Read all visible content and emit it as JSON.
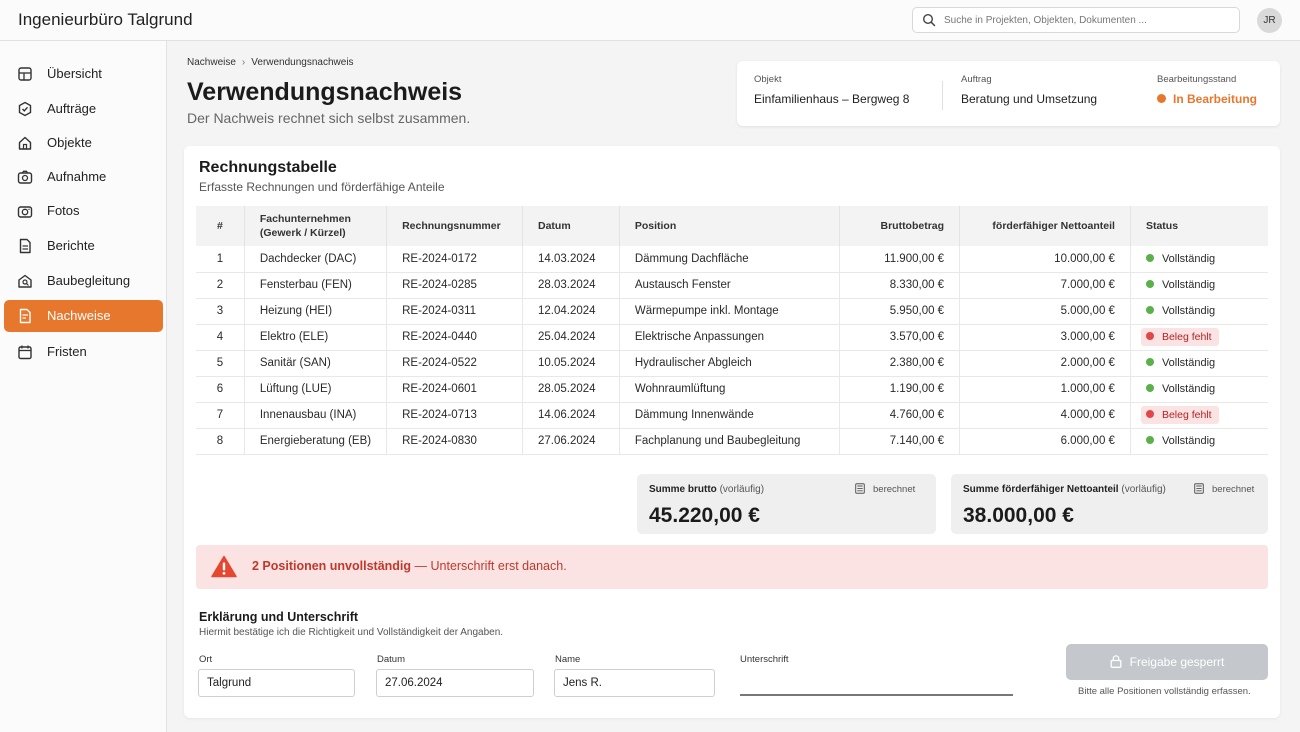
{
  "app": {
    "title": "Ingenieurbüro Talgrund"
  },
  "search": {
    "placeholder": "Suche in Projekten, Objekten, Dokumenten ..."
  },
  "user": {
    "initials": "JR"
  },
  "sidebar": {
    "items": [
      {
        "label": "Übersicht",
        "icon": "dashboard-icon"
      },
      {
        "label": "Aufträge",
        "icon": "order-badge-icon"
      },
      {
        "label": "Objekte",
        "icon": "home-icon"
      },
      {
        "label": "Aufnahme",
        "icon": "camera-icon"
      },
      {
        "label": "Fotos",
        "icon": "photo-camera-icon"
      },
      {
        "label": "Berichte",
        "icon": "document-icon"
      },
      {
        "label": "Baubegleitung",
        "icon": "building-icon"
      },
      {
        "label": "Nachweise",
        "icon": "certificate-icon",
        "active": true
      },
      {
        "label": "Fristen",
        "icon": "calendar-icon"
      }
    ]
  },
  "breadcrumb": {
    "parent": "Nachweise",
    "current": "Verwendungsnachweis"
  },
  "page": {
    "title": "Verwendungsnachweis",
    "subtitle": "Der Nachweis rechnet sich selbst zusammen."
  },
  "info": {
    "object_label": "Objekt",
    "object_value": "Einfamilienhaus – Bergweg 8",
    "order_label": "Auftrag",
    "order_value": "Beratung und Umsetzung",
    "state_label": "Bearbeitungsstand",
    "state_value": "In Bearbeitung"
  },
  "table": {
    "title": "Rechnungstabelle",
    "subtitle": "Erfasste Rechnungen und förderfähige Anteile",
    "headers": {
      "num": "#",
      "company_line1": "Fachunternehmen",
      "company_line2": "(Gewerk / Kürzel)",
      "invoice": "Rechnungsnummer",
      "date": "Datum",
      "position": "Position",
      "gross": "Bruttobetrag",
      "net": "förderfähiger Nettoanteil",
      "status": "Status"
    },
    "rows": [
      {
        "num": "1",
        "company": "Dachdecker (DAC)",
        "invoice": "RE-2024-0172",
        "date": "14.03.2024",
        "position": "Dämmung Dachfläche",
        "gross": "11.900,00 €",
        "net": "10.000,00 €",
        "status": "Vollständig",
        "ok": true
      },
      {
        "num": "2",
        "company": "Fensterbau (FEN)",
        "invoice": "RE-2024-0285",
        "date": "28.03.2024",
        "position": "Austausch Fenster",
        "gross": "8.330,00 €",
        "net": "7.000,00 €",
        "status": "Vollständig",
        "ok": true
      },
      {
        "num": "3",
        "company": "Heizung (HEI)",
        "invoice": "RE-2024-0311",
        "date": "12.04.2024",
        "position": "Wärmepumpe inkl. Montage",
        "gross": "5.950,00 €",
        "net": "5.000,00 €",
        "status": "Vollständig",
        "ok": true
      },
      {
        "num": "4",
        "company": "Elektro (ELE)",
        "invoice": "RE-2024-0440",
        "date": "25.04.2024",
        "position": "Elektrische Anpassungen",
        "gross": "3.570,00 €",
        "net": "3.000,00 €",
        "status": "Beleg fehlt",
        "ok": false
      },
      {
        "num": "5",
        "company": "Sanitär (SAN)",
        "invoice": "RE-2024-0522",
        "date": "10.05.2024",
        "position": "Hydraulischer Abgleich",
        "gross": "2.380,00 €",
        "net": "2.000,00 €",
        "status": "Vollständig",
        "ok": true
      },
      {
        "num": "6",
        "company": "Lüftung (LUE)",
        "invoice": "RE-2024-0601",
        "date": "28.05.2024",
        "position": "Wohnraumlüftung",
        "gross": "1.190,00 €",
        "net": "1.000,00 €",
        "status": "Vollständig",
        "ok": true
      },
      {
        "num": "7",
        "company": "Innenausbau (INA)",
        "invoice": "RE-2024-0713",
        "date": "14.06.2024",
        "position": "Dämmung Innenwände",
        "gross": "4.760,00 €",
        "net": "4.000,00 €",
        "status": "Beleg fehlt",
        "ok": false
      },
      {
        "num": "8",
        "company": "Energieberatung (EB)",
        "invoice": "RE-2024-0830",
        "date": "27.06.2024",
        "position": "Fachplanung und Baubegleitung",
        "gross": "7.140,00 €",
        "net": "6.000,00 €",
        "status": "Vollständig",
        "ok": true
      }
    ]
  },
  "sums": {
    "gross_label": "Summe brutto",
    "gross_suffix": "(vorläufig)",
    "gross_value": "45.220,00 €",
    "net_label": "Summe förderfähiger Nettoanteil",
    "net_suffix": "(vorläufig)",
    "net_value": "38.000,00 €",
    "calc_label": "berechnet"
  },
  "alert": {
    "strong": "2 Positionen unvollständig",
    "rest": " — Unterschrift erst danach."
  },
  "declaration": {
    "title": "Erklärung und Unterschrift",
    "subtitle": "Hiermit bestätige ich die Richtigkeit und Vollständigkeit der Angaben.",
    "ort_label": "Ort",
    "ort_value": "Talgrund",
    "datum_label": "Datum",
    "datum_value": "27.06.2024",
    "name_label": "Name",
    "name_value": "Jens R.",
    "sig_label": "Unterschrift",
    "button_label": "Freigabe gesperrt",
    "hint": "Bitte alle Positionen vollständig erfassen."
  },
  "colors": {
    "accent": "#e8772e",
    "ok": "#5bb04b",
    "bad": "#e04848",
    "alert_bg": "#fbe3e3",
    "alert_text": "#c0392b"
  }
}
